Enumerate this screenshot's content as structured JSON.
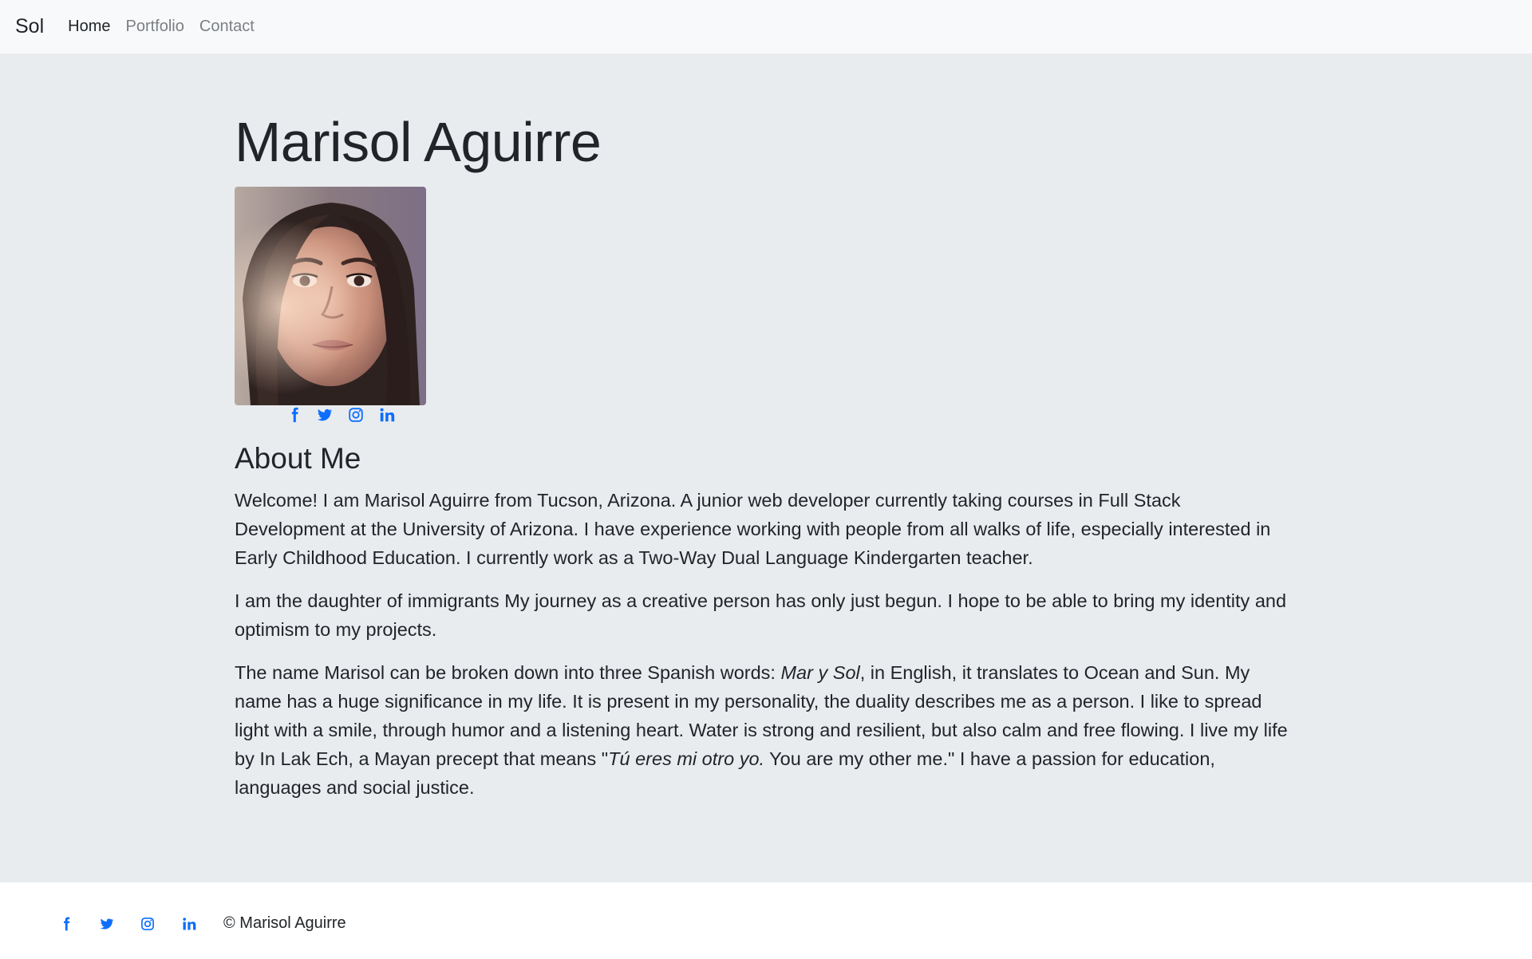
{
  "nav": {
    "brand": "Sol",
    "links": [
      {
        "label": "Home",
        "active": true
      },
      {
        "label": "Portfolio",
        "active": false
      },
      {
        "label": "Contact",
        "active": false
      }
    ]
  },
  "hero": {
    "name": "Marisol Aguirre"
  },
  "social": [
    "facebook-icon",
    "twitter-icon",
    "instagram-icon",
    "linkedin-icon"
  ],
  "about": {
    "heading": "About Me",
    "p1": "Welcome! I am Marisol Aguirre from Tucson, Arizona. A junior web developer currently taking courses in Full Stack Development at the University of Arizona. I have experience working with people from all walks of life, especially interested in Early Childhood Education. I currently work as a Two-Way Dual Language Kindergarten teacher.",
    "p2": "I am the daughter of immigrants My journey as a creative person has only just begun. I hope to be able to bring my identity and optimism to my projects.",
    "p3_a": "The name Marisol can be broken down into three Spanish words: ",
    "p3_em1": "Mar y Sol",
    "p3_b": ", in English, it translates to Ocean and Sun. My name has a huge significance in my life. It is present in my personality, the duality describes me as a person. I like to spread light with a smile, through humor and a listening heart. Water is strong and resilient, but also calm and free flowing. I live my life by In Lak Ech, a Mayan precept that means \"",
    "p3_em2": "Tú eres mi otro yo.",
    "p3_c": " You are my other me.\" I have a passion for education, languages and social justice."
  },
  "footer": {
    "copyright": "© Marisol Aguirre"
  },
  "colors": {
    "accent": "#0d6efd",
    "navbar_bg": "#f8f9fa",
    "jumbotron_bg": "#e9ecef"
  }
}
